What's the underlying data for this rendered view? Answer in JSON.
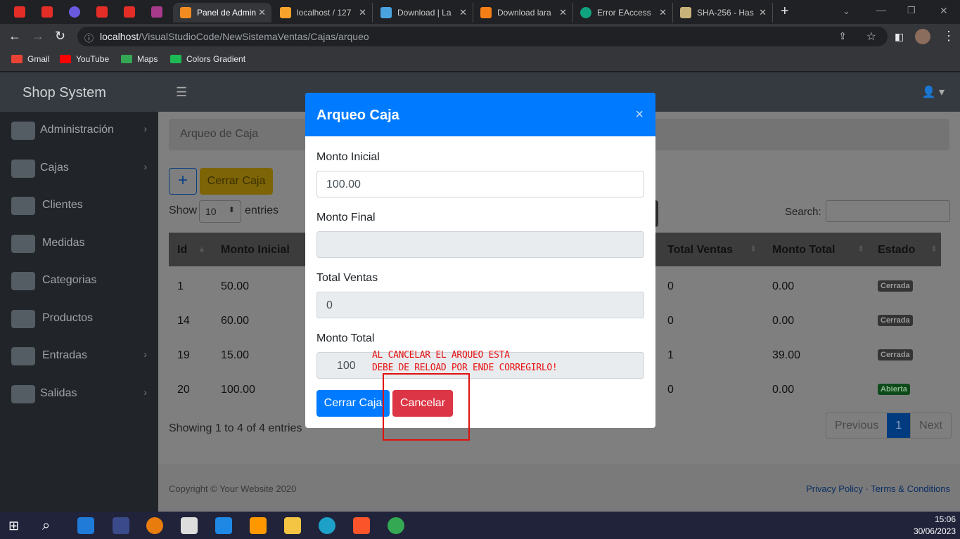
{
  "browser": {
    "tabs": [
      {
        "title": "Panel de Admin",
        "color": "#f28b20"
      },
      {
        "title": "localhost / 127",
        "color": "#f6a32c"
      },
      {
        "title": "Download | La",
        "color": "#4aa3df"
      },
      {
        "title": "Download lara",
        "color": "#f57f17"
      },
      {
        "title": "Error EAccess",
        "color": "#10a37f"
      },
      {
        "title": "SHA-256 - Has",
        "color": "#c9b27a"
      }
    ],
    "url_host": "localhost",
    "url_path": "/VisualStudioCode/NewSistemaVentas/Cajas/arqueo",
    "bookmarks": [
      "Gmail",
      "YouTube",
      "Maps",
      "Colors Gradient"
    ]
  },
  "app": {
    "brand": "Shop System",
    "sidebar": [
      {
        "label": "Administración",
        "chevron": "›"
      },
      {
        "label": "Cajas",
        "chevron": "›"
      },
      {
        "label": "Clientes",
        "chevron": ""
      },
      {
        "label": "Medidas",
        "chevron": ""
      },
      {
        "label": "Categorias",
        "chevron": ""
      },
      {
        "label": "Productos",
        "chevron": ""
      },
      {
        "label": "Entradas",
        "chevron": "›"
      },
      {
        "label": "Salidas",
        "chevron": "›"
      }
    ],
    "breadcrumb": "Arqueo de Caja",
    "add_label": "+",
    "cerrar_caja_label": "Cerrar Caja",
    "show_label": "Show",
    "show_value": "10",
    "entries_label": "entries",
    "search_label": "Search:",
    "columns": [
      "Id",
      "Monto Inicial",
      "Total Ventas",
      "Monto Total",
      "Estado"
    ],
    "rows": [
      {
        "id": "1",
        "inicial": "50.00",
        "ventas": "0",
        "total": "0.00",
        "estado": "Cerrada"
      },
      {
        "id": "14",
        "inicial": "60.00",
        "ventas": "0",
        "total": "0.00",
        "estado": "Cerrada"
      },
      {
        "id": "19",
        "inicial": "15.00",
        "ventas": "1",
        "total": "39.00",
        "estado": "Cerrada"
      },
      {
        "id": "20",
        "inicial": "100.00",
        "ventas": "0",
        "total": "0.00",
        "estado": "Abierta"
      }
    ],
    "showing": "Showing 1 to 4 of 4 entries",
    "pager": {
      "prev": "Previous",
      "page": "1",
      "next": "Next"
    },
    "copyright": "Copyright © Your Website 2020",
    "footer_links": "Privacy Policy · Terms & Conditions"
  },
  "modal": {
    "title": "Arqueo Caja",
    "close": "×",
    "monto_inicial_label": "Monto Inicial",
    "monto_inicial_value": "100.00",
    "monto_final_label": "Monto Final",
    "monto_final_value": "",
    "total_ventas_label": "Total Ventas",
    "total_ventas_value": "0",
    "monto_total_label": "Monto Total",
    "monto_total_value": "100",
    "annotation_line1": "AL CANCELAR EL ARQUEO ESTA",
    "annotation_line2": "DEBE DE RELOAD POR ENDE CORREGIRLO!",
    "btn_cerrar": "Cerrar Caja",
    "btn_cancelar": "Cancelar"
  },
  "taskbar": {
    "time": "15:06",
    "date": "30/06/2023"
  }
}
